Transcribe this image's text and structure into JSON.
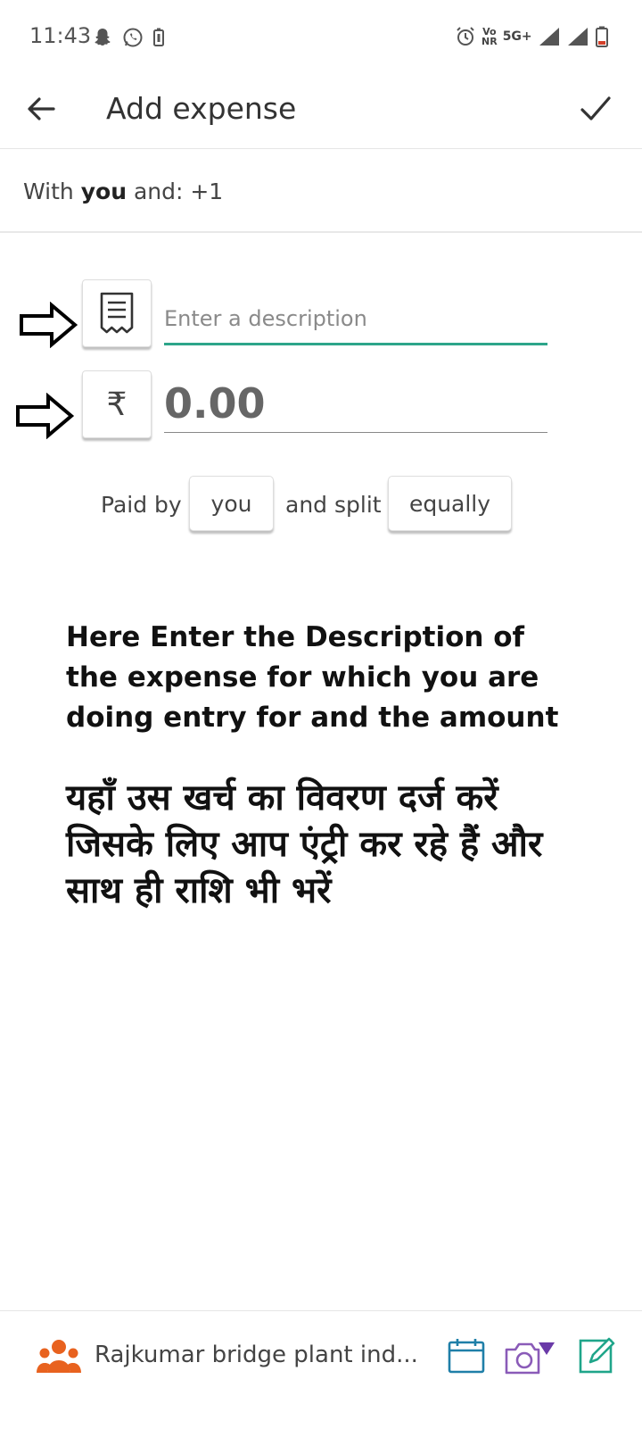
{
  "status_bar": {
    "time": "11:43",
    "net_top": "Vo",
    "net_bottom": "NR",
    "net_type": "5G+"
  },
  "header": {
    "title": "Add expense",
    "back_icon": "arrow-left-icon",
    "confirm_icon": "check-icon"
  },
  "with": {
    "prefix": "With ",
    "you": "you",
    "suffix": " and: +1"
  },
  "form": {
    "description_placeholder": "Enter a description",
    "description_value": "",
    "currency_symbol": "₹",
    "amount_placeholder": "0.00"
  },
  "split": {
    "paid_by_label": "Paid by",
    "payer": "you",
    "and_split_label": "and split",
    "split_mode": "equally"
  },
  "instructions": {
    "english": "Here Enter the Description of the expense for which you are doing entry for and the amount",
    "hindi": "यहाँ उस खर्च का विवरण दर्ज करें जिसके लिए आप एंट्री कर रहे हैं और साथ ही राशि भी भरें"
  },
  "bottom_bar": {
    "group_name": "Rajkumar bridge plant ind...",
    "accent": "#e8621f",
    "teal": "#1f7fa8",
    "purple": "#8a5bb8",
    "green": "#1fa58a"
  }
}
